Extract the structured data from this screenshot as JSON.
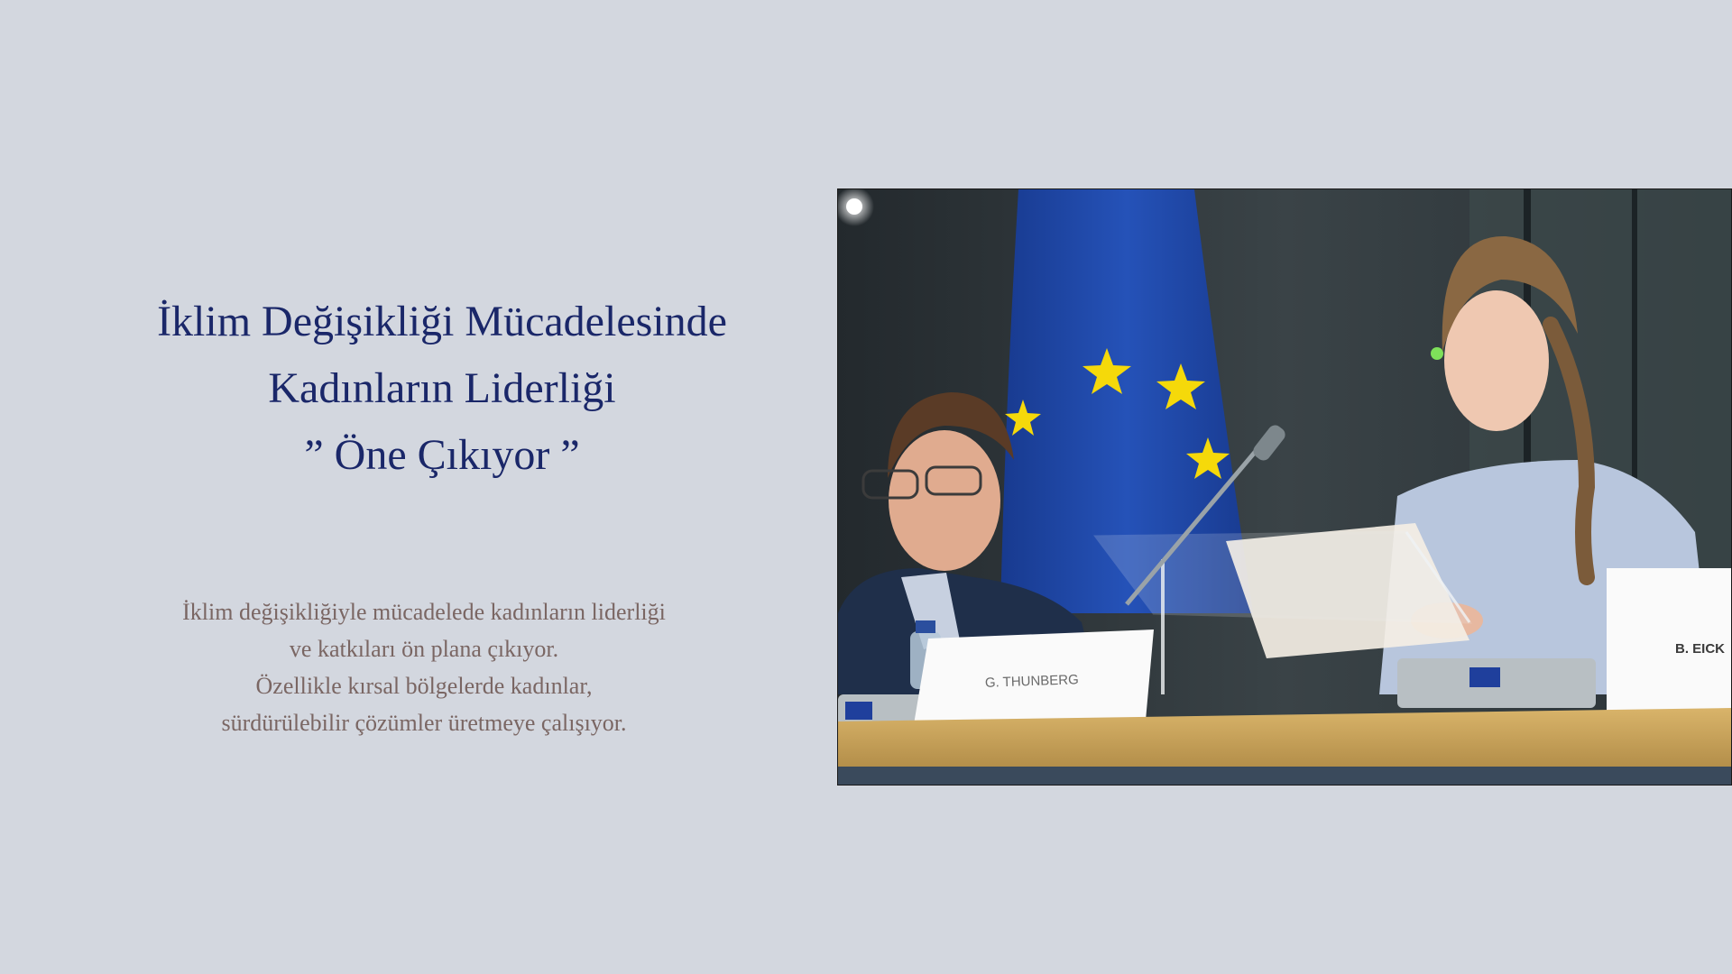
{
  "slide": {
    "title_lines": [
      "İklim Değişikliği Mücadelesinde",
      "Kadınların Liderliği",
      "” Öne Çıkıyor ”"
    ],
    "body_lines": [
      "İklim değişikliğiyle mücadelede kadınların liderliği",
      "ve katkıları ön plana çıkıyor.",
      "Özellikle kırsal bölgelerde kadınlar,",
      "sürdürülebilir çözümler üretmeye çalışıyor."
    ],
    "photo": {
      "name_card_left": "G. THUNBERG",
      "name_card_right": "B. EICK"
    }
  },
  "colors": {
    "background": "#d3d7df",
    "title": "#1a2769",
    "body": "#7a6663",
    "eu_blue": "#1f3f9c",
    "eu_star": "#f5d90a"
  }
}
